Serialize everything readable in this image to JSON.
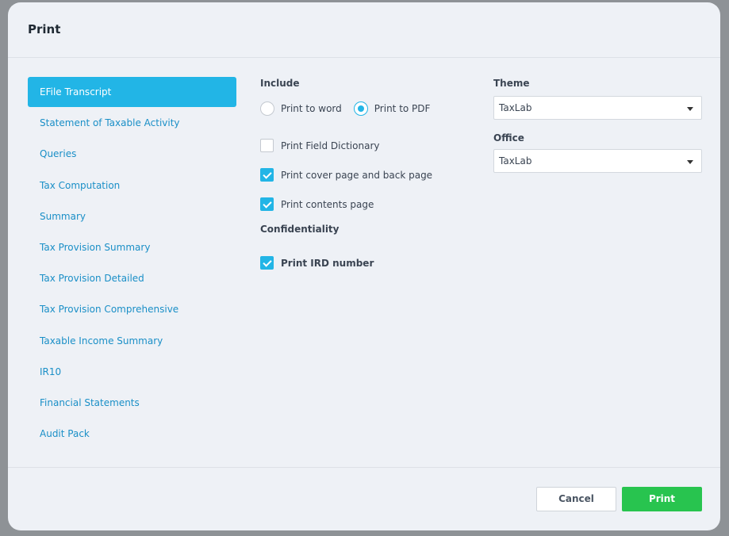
{
  "dialog": {
    "title": "Print"
  },
  "sidebar": {
    "items": [
      {
        "label": "EFile Transcript",
        "active": true
      },
      {
        "label": "Statement of Taxable Activity",
        "active": false
      },
      {
        "label": "Queries",
        "active": false
      },
      {
        "label": "Tax Computation",
        "active": false
      },
      {
        "label": "Summary",
        "active": false
      },
      {
        "label": "Tax Provision Summary",
        "active": false
      },
      {
        "label": "Tax Provision Detailed",
        "active": false
      },
      {
        "label": "Tax Provision Comprehensive",
        "active": false
      },
      {
        "label": "Taxable Income Summary",
        "active": false
      },
      {
        "label": "IR10",
        "active": false
      },
      {
        "label": "Financial Statements",
        "active": false
      },
      {
        "label": "Audit Pack",
        "active": false
      }
    ]
  },
  "include": {
    "label": "Include",
    "print_to_word": {
      "label": "Print to word",
      "checked": false
    },
    "print_to_pdf": {
      "label": "Print to PDF",
      "checked": true
    },
    "field_dictionary": {
      "label": "Print Field Dictionary",
      "checked": false
    },
    "cover_page": {
      "label": "Print cover page and back page",
      "checked": true
    },
    "contents_page": {
      "label": "Print contents page",
      "checked": true
    }
  },
  "confidentiality": {
    "label": "Confidentiality",
    "ird_number": {
      "label": "Print IRD number",
      "checked": true
    }
  },
  "theme": {
    "label": "Theme",
    "value": "TaxLab"
  },
  "office": {
    "label": "Office",
    "value": "TaxLab"
  },
  "footer": {
    "cancel_label": "Cancel",
    "print_label": "Print"
  },
  "colors": {
    "accent": "#22b5e6",
    "primary_button": "#28c44f",
    "link": "#1a8fc7"
  }
}
